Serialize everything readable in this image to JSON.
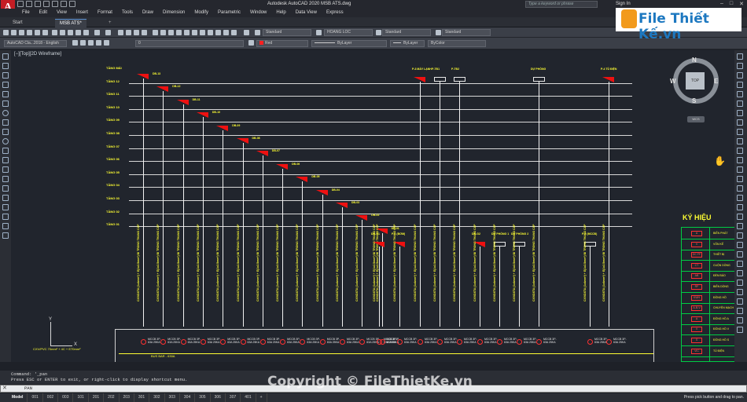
{
  "window": {
    "title": "Autodesk AutoCAD 2020   MSB ATS.dwg",
    "search_placeholder": "Type a keyword or phrase",
    "sign_in": "Sign In",
    "app_letter": "A"
  },
  "menu": [
    "File",
    "Edit",
    "View",
    "Insert",
    "Format",
    "Tools",
    "Draw",
    "Dimension",
    "Modify",
    "Parametric",
    "Window",
    "Help",
    "Data View",
    "Express"
  ],
  "tabs": {
    "start": "Start",
    "active": "MSB ATS*",
    "add": "+"
  },
  "ribbon": {
    "workspace": "AutoCAD Cla...2018 - English",
    "layer_value": "0",
    "text_style": "Standard",
    "dim_style": "HOANG LOC",
    "table_style": "Standard",
    "multileader_style": "Standard",
    "color": "Red",
    "linetype": "ByLayer",
    "lineweight": "ByLayer",
    "plot_style": "ByColor"
  },
  "viewport": {
    "label": "[−][Top][2D Wireframe]",
    "viewcube": {
      "face": "TOP",
      "n": "N",
      "s": "S",
      "e": "E",
      "w": "W",
      "wcs": "WCS"
    }
  },
  "drawing": {
    "floors": [
      "TẦNG MÁI",
      "TẦNG 12",
      "TẦNG 11",
      "TẦNG 10",
      "TẦNG 09",
      "TẦNG 08",
      "TẦNG 07",
      "TẦNG 06",
      "TẦNG 05",
      "TẦNG 04",
      "TẦNG 03",
      "TẦNG 02",
      "TẦNG 01"
    ],
    "panels": [
      "DB-13",
      "DB-12",
      "DB-11",
      "DB-10",
      "DB-09",
      "DB-08",
      "DB-07",
      "DB-06",
      "DB-05",
      "DB-04",
      "DB-03",
      "DB-02",
      "DB-01",
      "DB-G1",
      "P-1",
      "P-TĐ1",
      "P-TĐ2",
      "DỰ PHÒNG",
      "P-4"
    ],
    "top_right_panels": [
      "P-3 MÁY LẠNH",
      "P-TĐ1",
      "P-TĐ2",
      "DỰ PHÒNG",
      "P-4 TỦ ĐIỆN"
    ],
    "low_panels": [
      "DB-G1",
      "P-1 (BƠM)",
      "DB-G2",
      "DỰ PHÒNG 1",
      "DỰ PHÒNG 2",
      "P-2 (MCCB)"
    ],
    "cable_text": "CXV/DSTA (1x4mm²) + E(1x2.5mm²) ĐI TRONG THANG CÁP",
    "mccb_label": "MCCB 3P-63A 25KA",
    "busbar": "BUS BAR - 630A",
    "ucs_note": "CXV/PVC 70mm² + 4C + E70mm²",
    "ucs_x": "X",
    "ucs_y": "Y"
  },
  "legend": {
    "title": "KÝ HIỆU",
    "rows": [
      {
        "sym": "A",
        "text": "BIẾN PHÁT"
      },
      {
        "sym": "V",
        "text": "VÔN KẾ"
      },
      {
        "sym": "DC FF",
        "text": "THIẾT BỊ"
      },
      {
        "sym": "CT",
        "text": "CUỘN DÒNG"
      },
      {
        "sym": "AB",
        "text": "ĐÈN BÁO"
      },
      {
        "sym": "RF",
        "text": "BIẾN DÒNG"
      },
      {
        "sym": "KWH",
        "text": "ĐỒNG HỒ"
      },
      {
        "sym": "A-B-V",
        "text": "CHUYỂN MẠCH"
      },
      {
        "sym": "A",
        "text": "ĐỒNG HỒ A"
      },
      {
        "sym": "V",
        "text": "ĐỒNG HỒ V"
      },
      {
        "sym": "S",
        "text": "ĐỒNG HỒ S"
      },
      {
        "sym": "VIC",
        "text": "TỦ ĐIỆN"
      }
    ]
  },
  "command": {
    "history_1": "Command:  '_pan",
    "history_2": "Press ESC or ENTER to exit, or right-click to display shortcut menu.",
    "input": "PAN"
  },
  "layouts": [
    "Model",
    "001",
    "002",
    "003",
    "101",
    "201",
    "202",
    "203",
    "301",
    "302",
    "303",
    "304",
    "305",
    "306",
    "307",
    "401",
    "+"
  ],
  "status_message": "Press pick button and drag to pan.",
  "watermark": {
    "copyright": "Copyright © FileThietKe.vn",
    "brand": "File Thiết Kế.vn"
  },
  "colors": {
    "accent_red": "#c41d24",
    "cad_yellow": "#ffff33",
    "legend_green": "#00cc44",
    "panel_red": "#ee1111"
  }
}
